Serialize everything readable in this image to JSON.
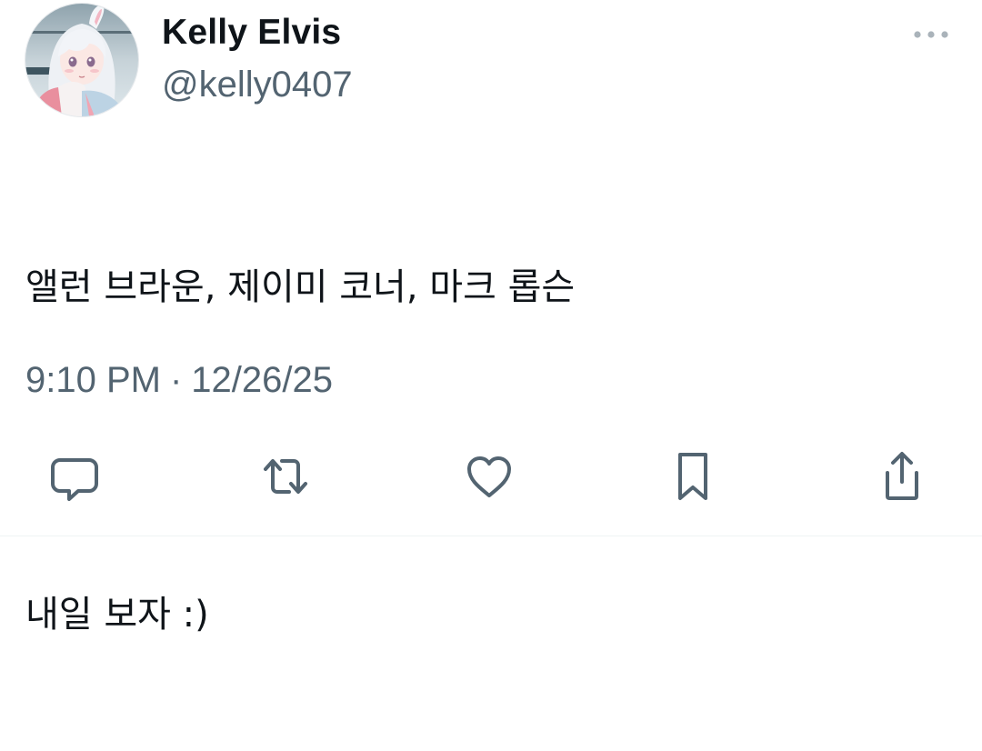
{
  "user": {
    "display_name": "Kelly Elvis",
    "handle": "@kelly0407",
    "avatar_icon": "anime-girl-avatar"
  },
  "tweet": {
    "lines": [
      "앨런 브라운, 제이미 코너, 마크 롭슨",
      "",
      "내일 보자 :)"
    ],
    "time": "9:10 PM",
    "separator": "·",
    "date": "12/26/25"
  },
  "actions": [
    {
      "name": "reply",
      "icon": "comment-icon"
    },
    {
      "name": "retweet",
      "icon": "retweet-icon"
    },
    {
      "name": "like",
      "icon": "heart-icon"
    },
    {
      "name": "bookmark",
      "icon": "bookmark-icon"
    },
    {
      "name": "share",
      "icon": "share-icon"
    }
  ],
  "colors": {
    "text_primary": "#0f1419",
    "text_secondary": "#536471",
    "icon": "#536471",
    "divider": "#eff3f4"
  }
}
